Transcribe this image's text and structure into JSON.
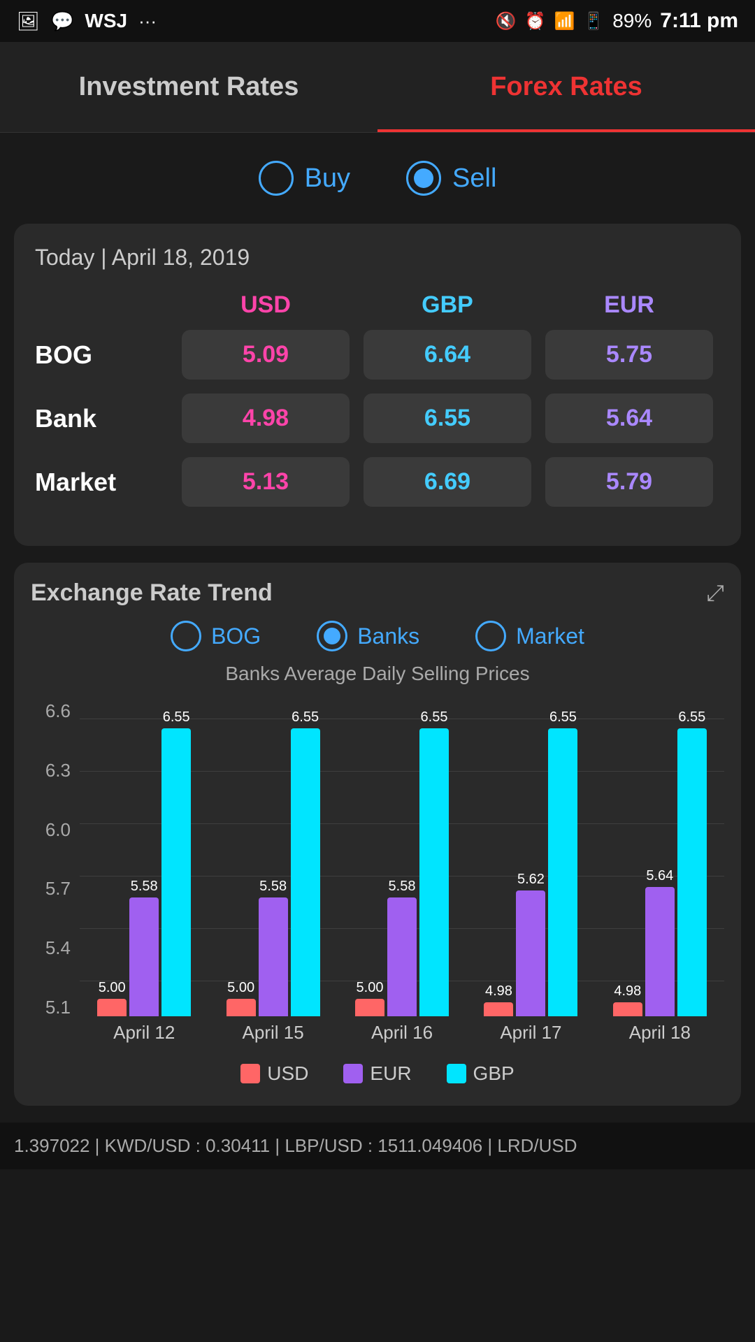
{
  "statusBar": {
    "leftItems": [
      "📷",
      "💬",
      "WSJ",
      "···"
    ],
    "battery": "89%",
    "time": "7:11 pm"
  },
  "header": {
    "tabs": [
      {
        "id": "investment",
        "label": "Investment Rates",
        "active": false
      },
      {
        "id": "forex",
        "label": "Forex Rates",
        "active": true
      }
    ]
  },
  "buySell": {
    "options": [
      {
        "id": "buy",
        "label": "Buy",
        "selected": false
      },
      {
        "id": "sell",
        "label": "Sell",
        "selected": true
      }
    ]
  },
  "ratesCard": {
    "dateLabel": "Today | April 18, 2019",
    "columns": [
      "USD",
      "GBP",
      "EUR"
    ],
    "rows": [
      {
        "label": "BOG",
        "values": {
          "usd": "5.09",
          "gbp": "6.64",
          "eur": "5.75"
        }
      },
      {
        "label": "Bank",
        "values": {
          "usd": "4.98",
          "gbp": "6.55",
          "eur": "5.64"
        }
      },
      {
        "label": "Market",
        "values": {
          "usd": "5.13",
          "gbp": "6.69",
          "eur": "5.79"
        }
      }
    ]
  },
  "chartCard": {
    "title": "Exchange Rate Trend",
    "radioOptions": [
      {
        "id": "bog",
        "label": "BOG",
        "selected": false
      },
      {
        "id": "banks",
        "label": "Banks",
        "selected": true
      },
      {
        "id": "market",
        "label": "Market",
        "selected": false
      }
    ],
    "subtitle": "Banks Average Daily Selling Prices",
    "yAxisLabels": [
      "5.1",
      "5.4",
      "5.7",
      "6.0",
      "6.3",
      "6.6"
    ],
    "xAxisLabels": [
      "April 12",
      "April 15",
      "April 16",
      "April 17",
      "April 18"
    ],
    "barGroups": [
      {
        "date": "April 12",
        "usd": {
          "value": 5.0,
          "label": "5.00"
        },
        "eur": {
          "value": 5.58,
          "label": "5.58"
        },
        "gbp": {
          "value": 6.55,
          "label": "6.55"
        }
      },
      {
        "date": "April 15",
        "usd": {
          "value": 5.0,
          "label": "5.00"
        },
        "eur": {
          "value": 5.58,
          "label": "5.58"
        },
        "gbp": {
          "value": 6.55,
          "label": "6.55"
        }
      },
      {
        "date": "April 16",
        "usd": {
          "value": 5.0,
          "label": "5.00"
        },
        "eur": {
          "value": 5.58,
          "label": "5.58"
        },
        "gbp": {
          "value": 6.55,
          "label": "6.55"
        }
      },
      {
        "date": "April 17",
        "usd": {
          "value": 4.98,
          "label": "4.98"
        },
        "eur": {
          "value": 5.62,
          "label": "5.62"
        },
        "gbp": {
          "value": 6.55,
          "label": "6.55"
        }
      },
      {
        "date": "April 18",
        "usd": {
          "value": 4.98,
          "label": "4.98"
        },
        "eur": {
          "value": 5.64,
          "label": "5.64"
        },
        "gbp": {
          "value": 6.55,
          "label": "6.55"
        }
      }
    ],
    "chartMin": 4.9,
    "chartMax": 6.7,
    "legend": [
      {
        "id": "usd",
        "label": "USD",
        "color": "#f66"
      },
      {
        "id": "eur",
        "label": "EUR",
        "color": "#a060f0"
      },
      {
        "id": "gbp",
        "label": "GBP",
        "color": "#00e5ff"
      }
    ]
  },
  "ticker": "1.397022 | KWD/USD : 0.30411 | LBP/USD : 1511.049406 | LRD/USD"
}
